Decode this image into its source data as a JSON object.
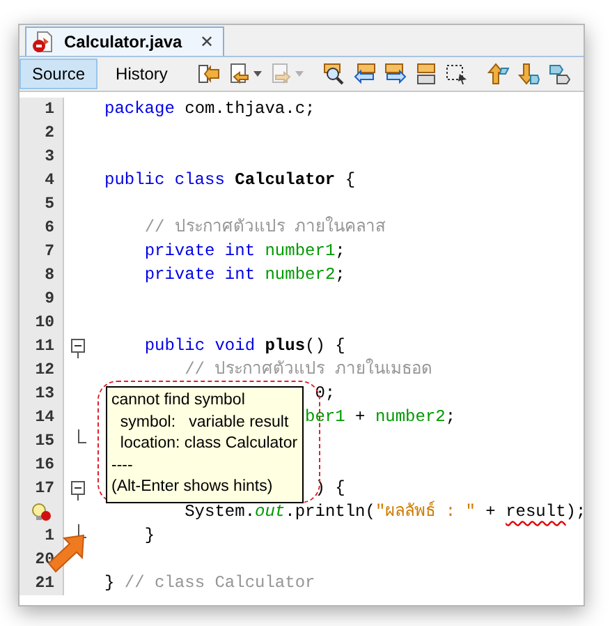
{
  "file_tabs": [
    {
      "title": "Calculator.java",
      "selected": true,
      "error": true,
      "close": "✕"
    }
  ],
  "view_tabs": [
    {
      "label": "Source",
      "selected": true
    },
    {
      "label": "History",
      "selected": false
    }
  ],
  "toolbar": [
    {
      "kind": "last-edit",
      "disabled": false
    },
    {
      "kind": "back",
      "disabled": false,
      "dropdown": true
    },
    {
      "kind": "forward",
      "disabled": true,
      "dropdown": true
    },
    {
      "kind": "find",
      "disabled": false
    },
    {
      "kind": "prev",
      "disabled": false
    },
    {
      "kind": "next",
      "disabled": false
    },
    {
      "kind": "highlight",
      "disabled": false
    },
    {
      "kind": "select",
      "disabled": false
    },
    {
      "kind": "up",
      "disabled": false
    },
    {
      "kind": "down",
      "disabled": false
    },
    {
      "kind": "bookmark",
      "disabled": false
    }
  ],
  "lines": [
    {
      "number": "1",
      "tokens": [
        {
          "kind": "keyword",
          "text": "package"
        },
        {
          "kind": "plain",
          "text": " com.thjava.c;"
        }
      ]
    },
    {
      "number": "2"
    },
    {
      "number": "3"
    },
    {
      "number": "4",
      "tokens": [
        {
          "kind": "keyword",
          "text": "public class"
        },
        {
          "kind": "bold",
          "text": " Calculator"
        },
        {
          "kind": "plain",
          "text": " {"
        }
      ]
    },
    {
      "number": "5"
    },
    {
      "number": "6",
      "tokens": [
        {
          "kind": "comment",
          "text": "    // ประกาศตัวแปร ภายในคลาส"
        }
      ]
    },
    {
      "number": "7",
      "tokens": [
        {
          "kind": "keyword",
          "text": "    private int"
        },
        {
          "kind": "field",
          "text": " number1"
        },
        {
          "kind": "plain",
          "text": ";"
        }
      ]
    },
    {
      "number": "8",
      "tokens": [
        {
          "kind": "keyword",
          "text": "    private int"
        },
        {
          "kind": "field",
          "text": " number2"
        },
        {
          "kind": "plain",
          "text": ";"
        }
      ]
    },
    {
      "number": "9"
    },
    {
      "number": "10"
    },
    {
      "number": "11",
      "fold_start": true,
      "tokens": [
        {
          "kind": "keyword",
          "text": "    public void"
        },
        {
          "kind": "bold",
          "text": " plus"
        },
        {
          "kind": "plain",
          "text": "() {"
        }
      ]
    },
    {
      "number": "12",
      "tokens": [
        {
          "kind": "comment",
          "text": "        // ประกาศตัวแปร ภายในเมธอด"
        }
      ]
    },
    {
      "number": "13",
      "tokens": [
        {
          "kind": "plain",
          "text": "                     0;"
        }
      ]
    },
    {
      "number": "14",
      "tokens": [
        {
          "kind": "field",
          "text": "                    ber1"
        },
        {
          "kind": "plain",
          "text": " + "
        },
        {
          "kind": "field",
          "text": "number2"
        },
        {
          "kind": "plain",
          "text": ";"
        }
      ]
    },
    {
      "number": "15",
      "fold_end": true
    },
    {
      "number": "16"
    },
    {
      "number": "17",
      "fold_start": true,
      "tokens": [
        {
          "kind": "plain",
          "text": "                     ) {"
        }
      ]
    },
    {
      "error_hint": true,
      "tokens": [
        {
          "kind": "plain",
          "text": "        System."
        },
        {
          "kind": "static",
          "text": "out"
        },
        {
          "kind": "plain",
          "text": ".println("
        },
        {
          "kind": "string",
          "text": "\"ผลลัพธ์ : \""
        },
        {
          "kind": "plain",
          "text": " + "
        },
        {
          "kind": "error",
          "text": "result"
        },
        {
          "kind": "plain",
          "text": ");"
        }
      ]
    },
    {
      "number": "1",
      "fold_end": true,
      "tokens": [
        {
          "kind": "plain",
          "text": "    }"
        }
      ]
    },
    {
      "number": "20"
    },
    {
      "number": "21",
      "tokens": [
        {
          "kind": "plain",
          "text": "} "
        },
        {
          "kind": "comment",
          "text": "// class Calculator"
        }
      ]
    }
  ],
  "tooltip": {
    "lines": [
      "cannot find symbol",
      "  symbol:   variable result",
      "  location: class Calculator",
      "----",
      "(Alt-Enter shows hints)"
    ]
  }
}
